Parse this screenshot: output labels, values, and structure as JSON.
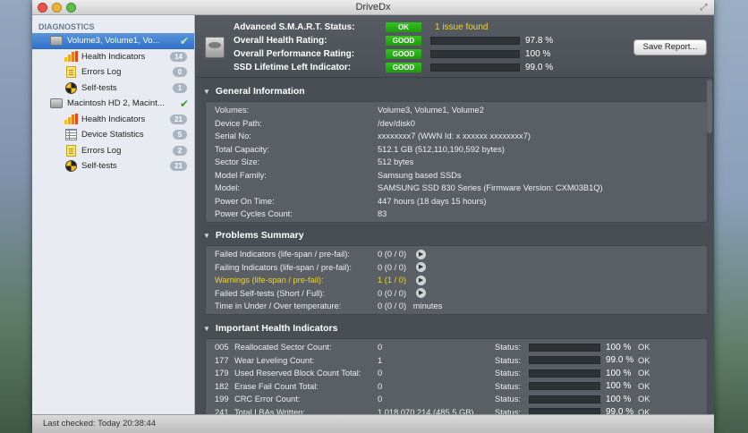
{
  "window": {
    "title": "DriveDx"
  },
  "sidebar": {
    "header": "DIAGNOSTICS",
    "items": [
      {
        "label": "Volume3, Volume1, Vo...",
        "icon": "hdd-icon",
        "level": 1,
        "badge": "",
        "check": "✔",
        "selected": true
      },
      {
        "label": "Health Indicators",
        "icon": "bar-chart-icon",
        "level": 2,
        "badge": "14"
      },
      {
        "label": "Errors Log",
        "icon": "document-icon",
        "level": 2,
        "badge": "0"
      },
      {
        "label": "Self-tests",
        "icon": "radiation-icon",
        "level": 2,
        "badge": "1"
      },
      {
        "label": "Macintosh HD 2, Macint...",
        "icon": "hdd-icon",
        "level": 1,
        "badge": "",
        "check": "✔"
      },
      {
        "label": "Health Indicators",
        "icon": "bar-chart-icon",
        "level": 2,
        "badge": "21"
      },
      {
        "label": "Device Statistics",
        "icon": "table-icon",
        "level": 2,
        "badge": "5"
      },
      {
        "label": "Errors Log",
        "icon": "document-icon",
        "level": 2,
        "badge": "2"
      },
      {
        "label": "Self-tests",
        "icon": "radiation-icon",
        "level": 2,
        "badge": "21"
      }
    ]
  },
  "statusbar": {
    "text": "Last checked: Today 20:38:44"
  },
  "summary": {
    "smart": {
      "label": "Advanced S.M.A.R.T. Status:",
      "pill": "OK",
      "issue": "1 issue found"
    },
    "health": {
      "label": "Overall Health Rating:",
      "pill": "GOOD",
      "percent": "97.8 %",
      "fill": 97.8
    },
    "performance": {
      "label": "Overall Performance Rating:",
      "pill": "GOOD",
      "percent": "100 %",
      "fill": 100
    },
    "ssd": {
      "label": "SSD Lifetime Left Indicator:",
      "pill": "GOOD",
      "percent": "99.0 %",
      "fill": 99.0
    },
    "save_label": "Save Report..."
  },
  "general": {
    "title": "General Information",
    "rows": [
      {
        "k": "Volumes:",
        "v": "Volume3, Volume1, Volume2"
      },
      {
        "k": "Device Path:",
        "v": "/dev/disk0"
      },
      {
        "k": "Serial No:",
        "v": "xxxxxxxx7 (WWN Id: x xxxxxx xxxxxxxx7)"
      },
      {
        "k": "Total Capacity:",
        "v": "512.1 GB (512,110,190,592 bytes)"
      },
      {
        "k": "Sector Size:",
        "v": "512 bytes"
      },
      {
        "k": "Model Family:",
        "v": "Samsung based SSDs"
      },
      {
        "k": "Model:",
        "v": "SAMSUNG SSD 830 Series  (Firmware Version: CXM03B1Q)"
      },
      {
        "k": "Power On Time:",
        "v": "447 hours (18 days 15 hours)"
      },
      {
        "k": "Power Cycles Count:",
        "v": "83"
      }
    ]
  },
  "problems": {
    "title": "Problems Summary",
    "rows": [
      {
        "k": "Failed Indicators (life-span / pre-fail):",
        "v": "0 (0 / 0)",
        "arrow": true,
        "warn": false
      },
      {
        "k": "Failing Indicators (life-span / pre-fail):",
        "v": "0 (0 / 0)",
        "arrow": true,
        "warn": false
      },
      {
        "k": "Warnings (life-span / pre-fail):",
        "v": "1 (1 / 0)",
        "arrow": true,
        "warn": true
      },
      {
        "k": "Failed Self-tests (Short / Full):",
        "v": "0 (0 / 0)",
        "arrow": true,
        "warn": false
      },
      {
        "k": "Time in Under / Over temperature:",
        "v": "0 (0 / 0)   minutes",
        "arrow": false,
        "warn": false
      }
    ]
  },
  "indicators": {
    "title": "Important Health Indicators",
    "status_label": "Status:",
    "rows": [
      {
        "id": "005",
        "name": "Reallocated Sector Count:",
        "value": "0",
        "percent": "100 %",
        "fill": 100,
        "state": "OK"
      },
      {
        "id": "177",
        "name": "Wear Leveling Count:",
        "value": "1",
        "percent": "99.0 %",
        "fill": 99,
        "state": "OK"
      },
      {
        "id": "179",
        "name": "Used Reserved Block Count Total:",
        "value": "0",
        "percent": "100 %",
        "fill": 100,
        "state": "OK"
      },
      {
        "id": "182",
        "name": "Erase Fail Count Total:",
        "value": "0",
        "percent": "100 %",
        "fill": 100,
        "state": "OK"
      },
      {
        "id": "199",
        "name": "CRC Error Count:",
        "value": "0",
        "percent": "100 %",
        "fill": 100,
        "state": "OK"
      },
      {
        "id": "241",
        "name": "Total LBAs Written:",
        "value": "1,018,070,214 (485.5 GB)",
        "percent": "99.0 %",
        "fill": 99,
        "state": "OK"
      }
    ]
  }
}
